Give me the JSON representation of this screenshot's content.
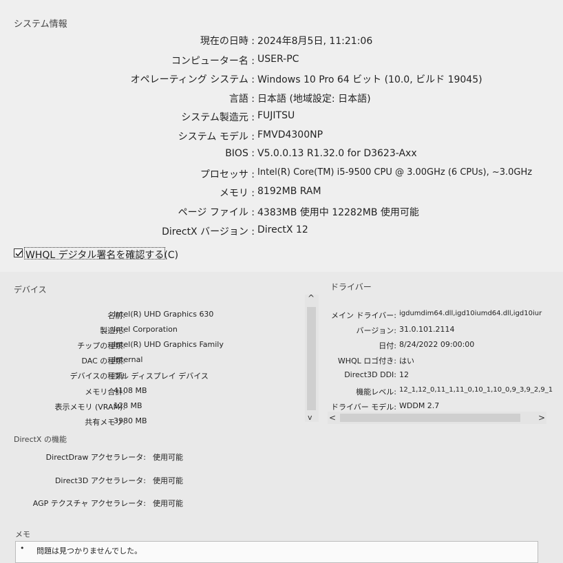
{
  "system_info": {
    "group_title": "システム情報",
    "rows": [
      {
        "label": "現在の日時 :",
        "value": "2024年8月5日, 11:21:06"
      },
      {
        "label": "コンピューター名 :",
        "value": "USER-PC"
      },
      {
        "label": "オペレーティング システム :",
        "value": "Windows 10 Pro 64 ビット (10.0, ビルド 19045)"
      },
      {
        "label": "言語 :",
        "value": "日本語 (地域設定: 日本語)"
      },
      {
        "label": "システム製造元 :",
        "value": "FUJITSU"
      },
      {
        "label": "システム モデル :",
        "value": "FMVD4300NP"
      },
      {
        "label": "BIOS :",
        "value": "V5.0.0.13 R1.32.0 for D3623-Axx"
      },
      {
        "label": "プロセッサ :",
        "value": "Intel(R) Core(TM) i5-9500 CPU @ 3.00GHz (6 CPUs), ~3.0GHz"
      },
      {
        "label": "メモリ :",
        "value": "8192MB RAM"
      },
      {
        "label": "ページ ファイル :",
        "value": "4383MB 使用中 12282MB 使用可能"
      },
      {
        "label": "DirectX バージョン :",
        "value": "DirectX 12"
      }
    ]
  },
  "whql_checkbox": {
    "label": "WHQL デジタル署名を確認する(C)",
    "checked": true
  },
  "device": {
    "group_title": "デバイス",
    "rows": [
      {
        "label": "名前:",
        "value": "Intel(R) UHD Graphics 630"
      },
      {
        "label": "製造元:",
        "value": "Intel Corporation"
      },
      {
        "label": "チップの種類:",
        "value": "Intel(R) UHD Graphics Family"
      },
      {
        "label": "DAC の種類:",
        "value": "Internal"
      },
      {
        "label": "デバイスの種類:",
        "value": "フル ディスプレイ デバイス"
      },
      {
        "label": "メモリ合計:",
        "value": "4108 MB"
      },
      {
        "label": "表示メモリ (VRAM):",
        "value": "128 MB"
      },
      {
        "label": "共有メモリ:",
        "value": "3980 MB"
      }
    ],
    "scroll_up": "^",
    "scroll_down": "v"
  },
  "driver": {
    "group_title": "ドライバー",
    "rows": [
      {
        "label": "メイン ドライバー:",
        "value": "igdumdim64.dll,igd10iumd64.dll,igd10iur"
      },
      {
        "label": "バージョン:",
        "value": "31.0.101.2114"
      },
      {
        "label": "日付:",
        "value": "8/24/2022 09:00:00"
      },
      {
        "label": "WHQL ロゴ付き:",
        "value": "はい"
      },
      {
        "label": "Direct3D DDI:",
        "value": "12"
      },
      {
        "label": "機能レベル:",
        "value": "12_1,12_0,11_1,11_0,10_1,10_0,9_3,9_2,9_1"
      },
      {
        "label": "ドライバー モデル:",
        "value": "WDDM 2.7"
      }
    ],
    "scroll_left": "<",
    "scroll_right": ">"
  },
  "directx_features": {
    "group_title": "DirectX の機能",
    "rows": [
      {
        "label": "DirectDraw アクセラレータ:",
        "value": "使用可能"
      },
      {
        "label": "Direct3D アクセラレータ:",
        "value": "使用可能"
      },
      {
        "label": "AGP テクスチャ アクセラレータ:",
        "value": "使用可能"
      }
    ]
  },
  "notes": {
    "group_title": "メモ",
    "items": [
      "問題は見つかりませんでした。"
    ]
  }
}
